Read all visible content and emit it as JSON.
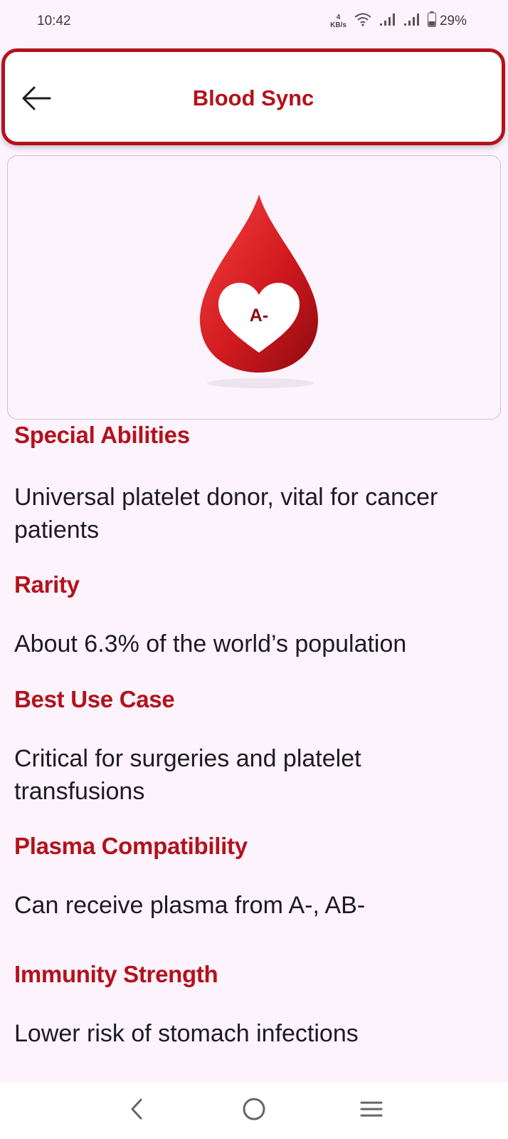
{
  "status_bar": {
    "time": "10:42",
    "net_speed_value": "4",
    "net_speed_unit": "KB/s",
    "battery": "29%"
  },
  "app_bar": {
    "title": "Blood Sync",
    "back_icon": "arrow-left-icon"
  },
  "blood_card": {
    "blood_type": "A-",
    "icon": "blood-drop-heart-icon",
    "colors": {
      "drop_light": "#f03a3c",
      "drop_dark": "#9c0d12",
      "accent": "#b3121c"
    }
  },
  "sections": [
    {
      "heading": "Special Abilities",
      "body": "Universal platelet donor, vital for cancer patients"
    },
    {
      "heading": "Rarity",
      "body": "About 6.3% of the world’s population"
    },
    {
      "heading": "Best Use Case",
      "body": "Critical for surgeries and platelet transfusions"
    },
    {
      "heading": "Plasma Compatibility",
      "body": "Can receive plasma from A-, AB-"
    },
    {
      "heading": "Immunity Strength",
      "body": "Lower risk of stomach infections"
    }
  ],
  "nav_bar": {
    "back": "chevron-left-icon",
    "home": "circle-home-icon",
    "menu": "menu-lines-icon"
  }
}
